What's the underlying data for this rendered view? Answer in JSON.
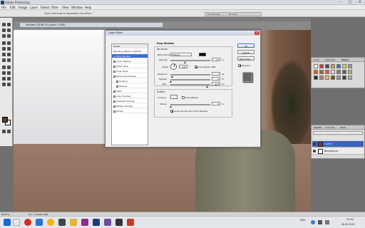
{
  "app": {
    "title": "Adobe Photoshop"
  },
  "menu": [
    "File",
    "Edit",
    "Image",
    "Layer",
    "Select",
    "Filter",
    "View",
    "Window",
    "Help"
  ],
  "options": {
    "hint": "Click and drag to reposition the effect.",
    "tab1": "File Browser",
    "tab2": "Brushes"
  },
  "document": {
    "title": "Untitled-1 @ 66.7% (Layer 1, RGB)"
  },
  "dialog": {
    "title": "Layer Style",
    "styles_header": "Styles",
    "blending": "Blending Options: Default",
    "items": [
      {
        "label": "Drop Shadow",
        "on": true,
        "checked": true
      },
      {
        "label": "Inner Shadow",
        "on": false,
        "checked": false
      },
      {
        "label": "Outer Glow",
        "on": false,
        "checked": false
      },
      {
        "label": "Inner Glow",
        "on": false,
        "checked": false
      },
      {
        "label": "Bevel and Emboss",
        "on": false,
        "checked": false
      },
      {
        "label": "Contour",
        "on": false,
        "checked": false,
        "indent": true
      },
      {
        "label": "Texture",
        "on": false,
        "checked": false,
        "indent": true
      },
      {
        "label": "Satin",
        "on": false,
        "checked": false
      },
      {
        "label": "Color Overlay",
        "on": false,
        "checked": false
      },
      {
        "label": "Gradient Overlay",
        "on": false,
        "checked": false
      },
      {
        "label": "Pattern Overlay",
        "on": false,
        "checked": false
      },
      {
        "label": "Stroke",
        "on": false,
        "checked": false
      }
    ],
    "drop_shadow": {
      "group_title": "Drop Shadow",
      "structure_title": "Structure",
      "blend_mode_label": "Blend Mode:",
      "blend_mode": "Multiply",
      "opacity_label": "Opacity:",
      "opacity": "37",
      "angle_label": "Angle:",
      "angle": "120",
      "global_light_label": "Use Global Light",
      "distance_label": "Distance:",
      "distance": "7",
      "spread_label": "Spread:",
      "spread": "0",
      "size_label": "Size:",
      "size": "222",
      "pct": "%",
      "deg": "°",
      "px": "px",
      "quality_title": "Quality",
      "contour_label": "Contour:",
      "antialiased_label": "Anti-aliased",
      "noise_label": "Noise:",
      "noise": "0",
      "knockout_label": "Layer Knocks Out Drop Shadow"
    },
    "buttons": {
      "ok": "OK",
      "cancel": "Cancel",
      "new_style": "New Style...",
      "preview": "Preview"
    }
  },
  "panels": {
    "styles_tabs": [
      "Color",
      "Swatches",
      "Styles"
    ],
    "layers_tabs": [
      "Layers",
      "Channels",
      "Paths"
    ],
    "layers": [
      {
        "name": "Layer 1",
        "selected": true
      },
      {
        "name": "Background",
        "selected": false
      }
    ]
  },
  "status": {
    "zoom": "66.67%",
    "doc": "Doc: 2.64M/2.64M"
  },
  "taskbar": {
    "lang": "ENG",
    "time": "21:04",
    "date": "28-05-2022"
  }
}
